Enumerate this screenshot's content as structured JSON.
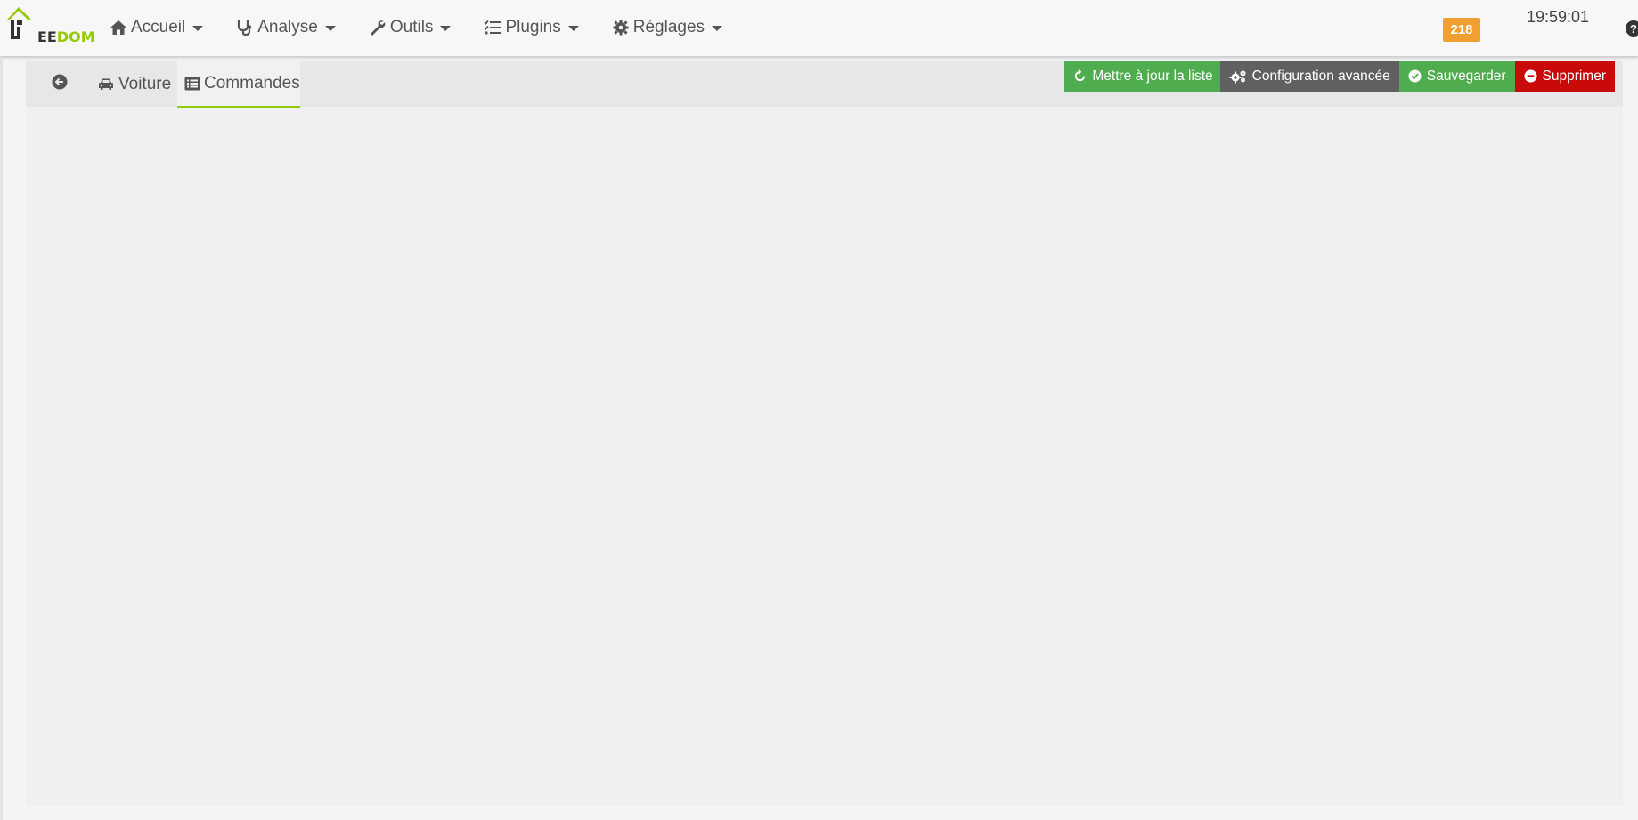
{
  "app": {
    "logo_text_left": "EE",
    "logo_text_right": "DOM"
  },
  "nav": {
    "items": [
      {
        "label": "Accueil",
        "icon": "home-icon"
      },
      {
        "label": "Analyse",
        "icon": "stethoscope-icon"
      },
      {
        "label": "Outils",
        "icon": "wrench-icon"
      },
      {
        "label": "Plugins",
        "icon": "tasks-icon"
      },
      {
        "label": "Réglages",
        "icon": "gear-icon"
      }
    ]
  },
  "status": {
    "badge_count": "218",
    "time": "19:59:01",
    "help_glyph": "?"
  },
  "tabs": {
    "back_icon": "arrow-circle-left-icon",
    "voiture_label": "Voiture",
    "voiture_icon": "car-icon",
    "commandes_label": "Commandes",
    "commandes_icon": "list-alt-icon",
    "active": "Commandes"
  },
  "actions": {
    "refresh_label": "Mettre à jour la liste",
    "config_label": "Configuration avancée",
    "save_label": "Sauvegarder",
    "delete_label": "Supprimer"
  },
  "colors": {
    "accent_green": "#94ca02",
    "success_green": "#4fad4f",
    "danger_red": "#c90a0a",
    "neutral_gray": "#606060",
    "badge_orange": "#f0a030"
  }
}
